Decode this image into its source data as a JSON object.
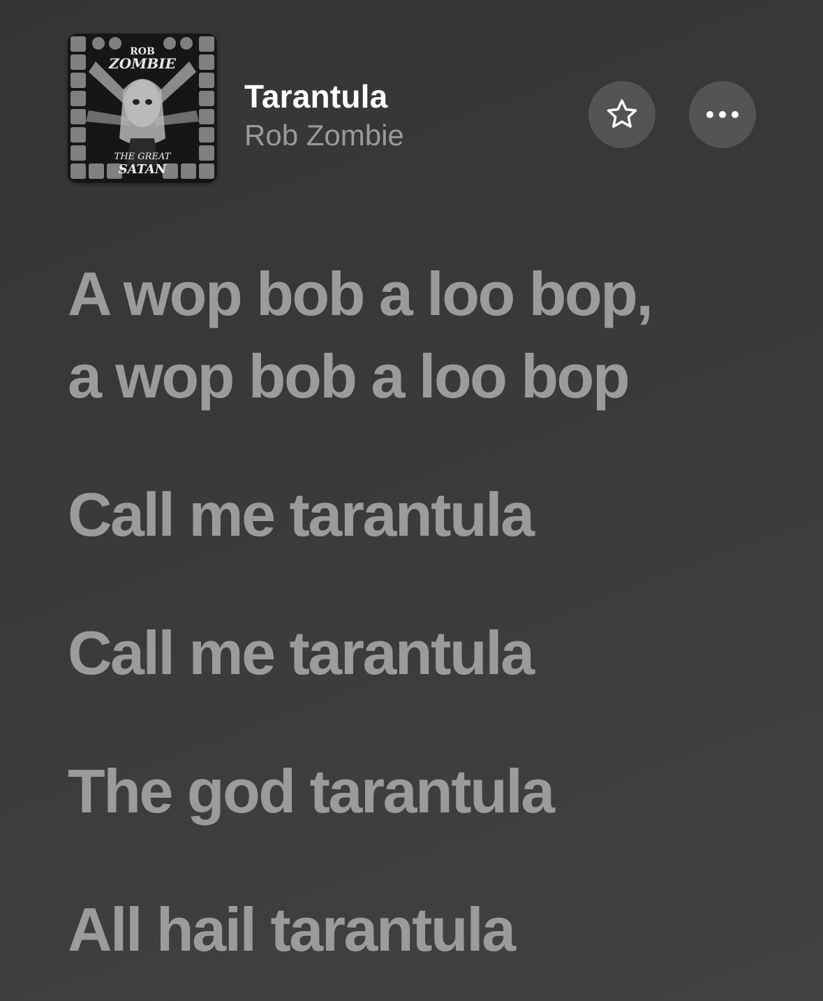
{
  "now_playing": {
    "title": "Tarantula",
    "artist": "Rob Zombie",
    "album_art_text": {
      "band": "ROB ZOMBIE",
      "album": "THE GREAT SATAN"
    },
    "favorite_icon": "star-outline-icon",
    "more_icon": "ellipsis-icon"
  },
  "lyrics": [
    "A wop bob a loo bop,\na wop bob a loo bop",
    "Call me tarantula",
    "Call me tarantula",
    "The god tarantula",
    "All hail tarantula"
  ],
  "colors": {
    "background": "#3a3a3a",
    "title": "#ffffff",
    "artist": "#9a9a9a",
    "lyric": "#9b9b9b",
    "button_bg": "#545454"
  }
}
